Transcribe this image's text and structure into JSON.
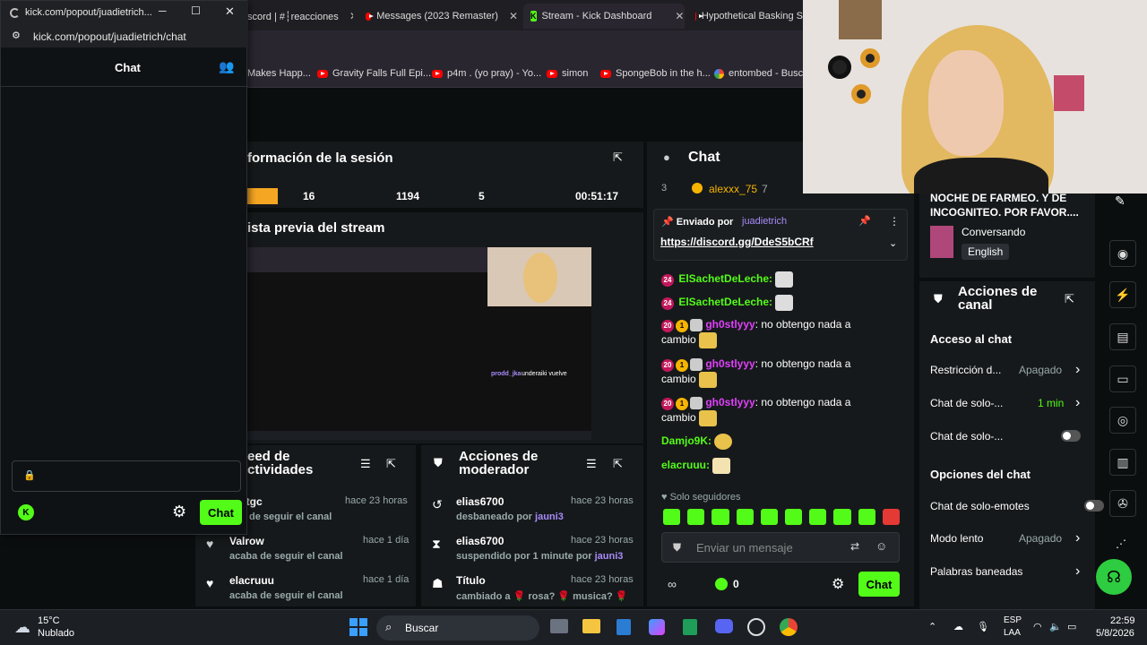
{
  "browser": {
    "tabs": [
      {
        "label": "scord | #┆reacciones"
      },
      {
        "label": "Messages (2023 Remaster)"
      },
      {
        "label": "Stream - Kick Dashboard"
      },
      {
        "label": "Hypothetical Basking S"
      }
    ],
    "bookmarks": [
      "Makes Happ...",
      "Gravity Falls Full Epi...",
      "p4m . (yo pray) - Yo...",
      "simon",
      "SpongeBob in the h...",
      "entombed - Busca"
    ]
  },
  "popout": {
    "window_title": "kick.com/popout/juadietrich...",
    "url": "kick.com/popout/juadietrich/chat",
    "header": "Chat",
    "send_label": "Chat"
  },
  "session": {
    "title": "formación de la sesión",
    "stats": [
      "16",
      "1194",
      "5",
      "00:51:17"
    ]
  },
  "preview": {
    "title": "ista previa del stream",
    "overlay_user": "prodd_jka",
    "overlay_msg": "underaiki vuelve"
  },
  "feed": {
    "title": "eed de\nctividades",
    "title_l1": "eed de",
    "title_l2": "ctividades",
    "items": [
      {
        "user": "dertgc",
        "time": "hace 23 horas",
        "desc": "aba de seguir el canal"
      },
      {
        "user": "Valrow",
        "time": "hace 1 día",
        "desc": "acaba de seguir el canal"
      },
      {
        "user": "elacruuu",
        "time": "hace 1 día",
        "desc": "acaba de seguir el canal"
      }
    ]
  },
  "mod": {
    "title_l1": "Acciones de",
    "title_l2": "moderador",
    "items": [
      {
        "user": "elias6700",
        "time": "hace 23 horas",
        "desc": "desbaneado por ",
        "by": "jauni3"
      },
      {
        "user": "elias6700",
        "time": "hace 23 horas",
        "desc": "suspendido por 1 minute por ",
        "by": "jauni3"
      },
      {
        "user": "Título",
        "time": "hace 23 horas",
        "desc": "cambiado a 🌹 rosa? 🌹 musica? 🌹",
        "by": ""
      }
    ]
  },
  "chat": {
    "title": "Chat",
    "top_rank": "3",
    "top_user": "alexxx_75",
    "top_count": "7",
    "pinned_by_label": "Enviado por",
    "pinned_user": "juadietrich",
    "pinned_link": "https://discord.gg/DdeS5bCRf",
    "messages": [
      {
        "badge": "24",
        "user": "ElSachetDeLeche:",
        "text": "",
        "color": "#53fc18"
      },
      {
        "badge": "24",
        "user": "ElSachetDeLeche:",
        "text": "",
        "color": "#53fc18"
      },
      {
        "badge": "20",
        "user": "gh0stlyyy",
        "text": ": no obtengo nada a",
        "cont": "cambio",
        "color": "#e040fb"
      },
      {
        "badge": "20",
        "user": "gh0stlyyy",
        "text": ": no obtengo nada a",
        "cont": "cambio",
        "color": "#e040fb"
      },
      {
        "badge": "20",
        "user": "gh0stlyyy",
        "text": ": no obtengo nada a",
        "cont": "cambio",
        "color": "#e040fb"
      },
      {
        "badge": "",
        "user": "Damjo9K:",
        "text": "",
        "color": "#53fc18"
      },
      {
        "badge": "",
        "user": "elacruuu:",
        "text": "",
        "color": "#53fc18"
      }
    ],
    "followers_only": "Solo seguidores",
    "input_placeholder": "Enviar un mensaje",
    "viewer_count": "0",
    "send_label": "Chat"
  },
  "right": {
    "stream_title_l1": "NOCHE DE FARMEO. Y DE",
    "stream_title_l2": "INCOGNITEO. POR FAVOR....",
    "category": "Conversando",
    "language": "English",
    "actions_l1": "Acciones de",
    "actions_l2": "canal",
    "access_heading": "Acceso al chat",
    "access_rows": [
      {
        "label": "Restricción d...",
        "value": "Apagado"
      },
      {
        "label": "Chat de solo-...",
        "value": "1 min"
      },
      {
        "label": "Chat de solo-...",
        "value": ""
      }
    ],
    "options_heading": "Opciones del chat",
    "options_rows": [
      {
        "label": "Chat de solo-emotes",
        "value": ""
      },
      {
        "label": "Modo lento",
        "value": "Apagado"
      },
      {
        "label": "Palabras baneadas",
        "value": ""
      }
    ]
  },
  "taskbar": {
    "weather_temp": "15°C",
    "weather_desc": "Nublado",
    "search": "Buscar",
    "lang": "ESP",
    "lang2": "LAA",
    "time": "22:59",
    "date": "5/8/2026"
  }
}
